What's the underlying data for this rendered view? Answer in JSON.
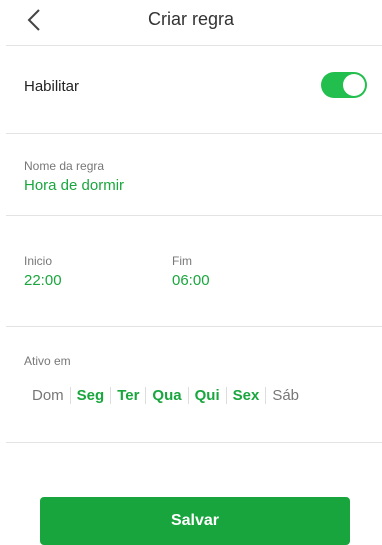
{
  "header": {
    "title": "Criar regra"
  },
  "enable": {
    "label": "Habilitar",
    "on": true
  },
  "rule_name": {
    "label": "Nome da regra",
    "value": "Hora de dormir"
  },
  "schedule": {
    "start_label": "Inicio",
    "start_value": "22:00",
    "end_label": "Fim",
    "end_value": "06:00"
  },
  "active_days": {
    "label": "Ativo em",
    "days": [
      {
        "label": "Dom",
        "active": false
      },
      {
        "label": "Seg",
        "active": true
      },
      {
        "label": "Ter",
        "active": true
      },
      {
        "label": "Qua",
        "active": true
      },
      {
        "label": "Qui",
        "active": true
      },
      {
        "label": "Sex",
        "active": true
      },
      {
        "label": "Sáb",
        "active": false
      }
    ]
  },
  "save_button": {
    "label": "Salvar"
  },
  "colors": {
    "accent": "#1aa63e",
    "toggle_on": "#22bf4e",
    "button": "#19a53e"
  }
}
